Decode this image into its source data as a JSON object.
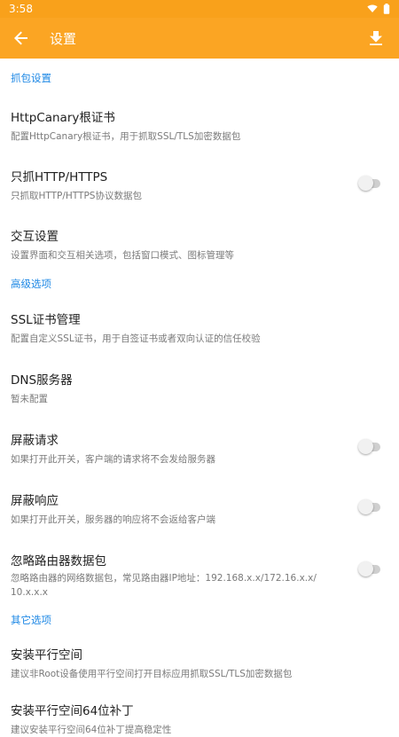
{
  "status_bar": {
    "time": "3:58",
    "wifi_icon": "wifi-icon",
    "battery_icon": "battery-icon"
  },
  "app_bar": {
    "title": "设置",
    "back_icon": "arrow-back-icon",
    "download_icon": "download-icon",
    "color": "#fba523"
  },
  "accent_color": "#1e88e5",
  "sections": [
    {
      "header": "抓包设置"
    },
    {
      "header": "高级选项"
    },
    {
      "header": "其它选项"
    }
  ],
  "items": [
    {
      "title": "HttpCanary根证书",
      "subtitle": "配置HttpCanary根证书，用于抓取SSL/TLS加密数据包"
    },
    {
      "title": "只抓HTTP/HTTPS",
      "subtitle": "只抓取HTTP/HTTPS协议数据包",
      "switch_on": false
    },
    {
      "title": "交互设置",
      "subtitle": "设置界面和交互相关选项，包括窗口模式、图标管理等"
    },
    {
      "title": "SSL证书管理",
      "subtitle": "配置自定义SSL证书，用于自签证书或者双向认证的信任校验"
    },
    {
      "title": "DNS服务器",
      "subtitle": "暂未配置"
    },
    {
      "title": "屏蔽请求",
      "subtitle": "如果打开此开关，客户端的请求将不会发给服务器",
      "switch_on": false
    },
    {
      "title": "屏蔽响应",
      "subtitle": "如果打开此开关，服务器的响应将不会返给客户端",
      "switch_on": false
    },
    {
      "title": "忽略路由器数据包",
      "subtitle": "忽略路由器的网络数据包，常见路由器IP地址：192.168.x.x/172.16.x.x/",
      "subtitle2": "10.x.x.x",
      "switch_on": false
    },
    {
      "title": "安装平行空间",
      "subtitle": "建议非Root设备使用平行空间打开目标应用抓取SSL/TLS加密数据包"
    },
    {
      "title": "安装平行空间64位补丁",
      "subtitle": "建议安装平行空间64位补丁提高稳定性"
    }
  ]
}
